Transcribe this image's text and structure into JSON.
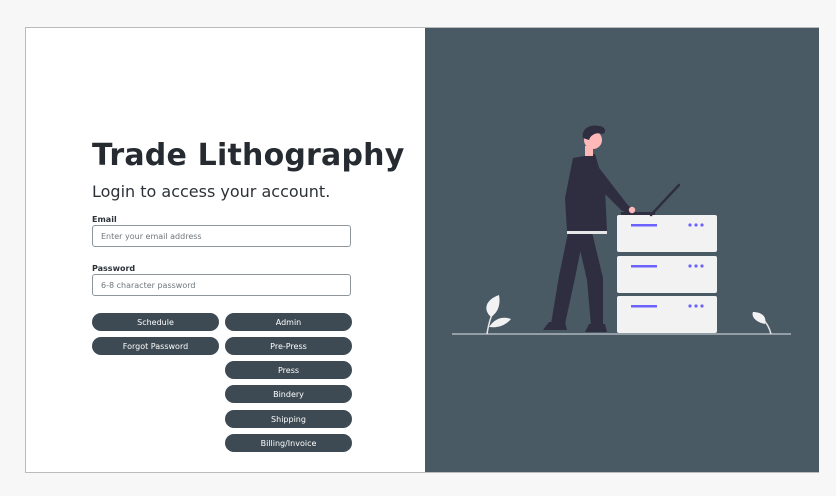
{
  "app": {
    "title": "Trade Lithography",
    "subtitle": "Login to access your account."
  },
  "form": {
    "email_label": "Email",
    "email_placeholder": "Enter your email address",
    "email_value": "",
    "password_label": "Password",
    "password_placeholder": "6-8 character password",
    "password_value": ""
  },
  "buttons": {
    "schedule": "Schedule",
    "forgot_password": "Forgot Password",
    "admin": "Admin",
    "pre_press": "Pre-Press",
    "press": "Press",
    "bindery": "Bindery",
    "shipping": "Shipping",
    "billing_invoice": "Billing/Invoice"
  },
  "colors": {
    "panel": "#495a65",
    "button": "#3d4a53",
    "accent": "#6c63ff",
    "server": "#f2f2f2"
  },
  "illustration": {
    "icon": "person-with-laptop-server-illustration"
  }
}
